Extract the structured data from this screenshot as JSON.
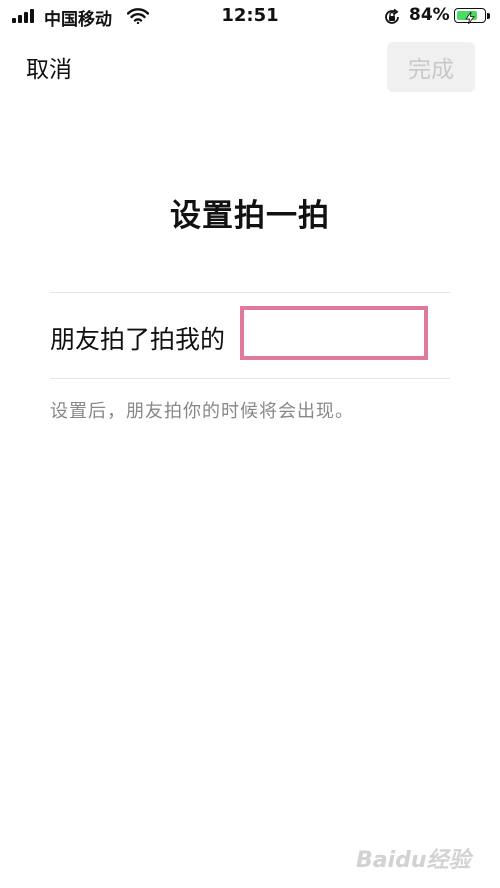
{
  "status_bar": {
    "carrier": "中国移动",
    "time": "12:51",
    "battery_percent": "84%",
    "battery_level": 0.84,
    "signal_bars": 4,
    "icons": [
      "signal-icon",
      "wifi-icon",
      "orientation-lock-icon",
      "battery-charging-icon"
    ],
    "battery_color": "#4cd964"
  },
  "nav": {
    "cancel_label": "取消",
    "done_label": "完成",
    "done_bg": "#f0f0f0",
    "done_text_color": "#c9c9c9"
  },
  "page": {
    "title": "设置拍一拍",
    "row_label": "朋友拍了拍我的",
    "input_value": "",
    "input_highlight_color": "#e07a9a",
    "hint": "设置后，朋友拍你的时候将会出现。"
  },
  "watermark": "Baidu经验"
}
